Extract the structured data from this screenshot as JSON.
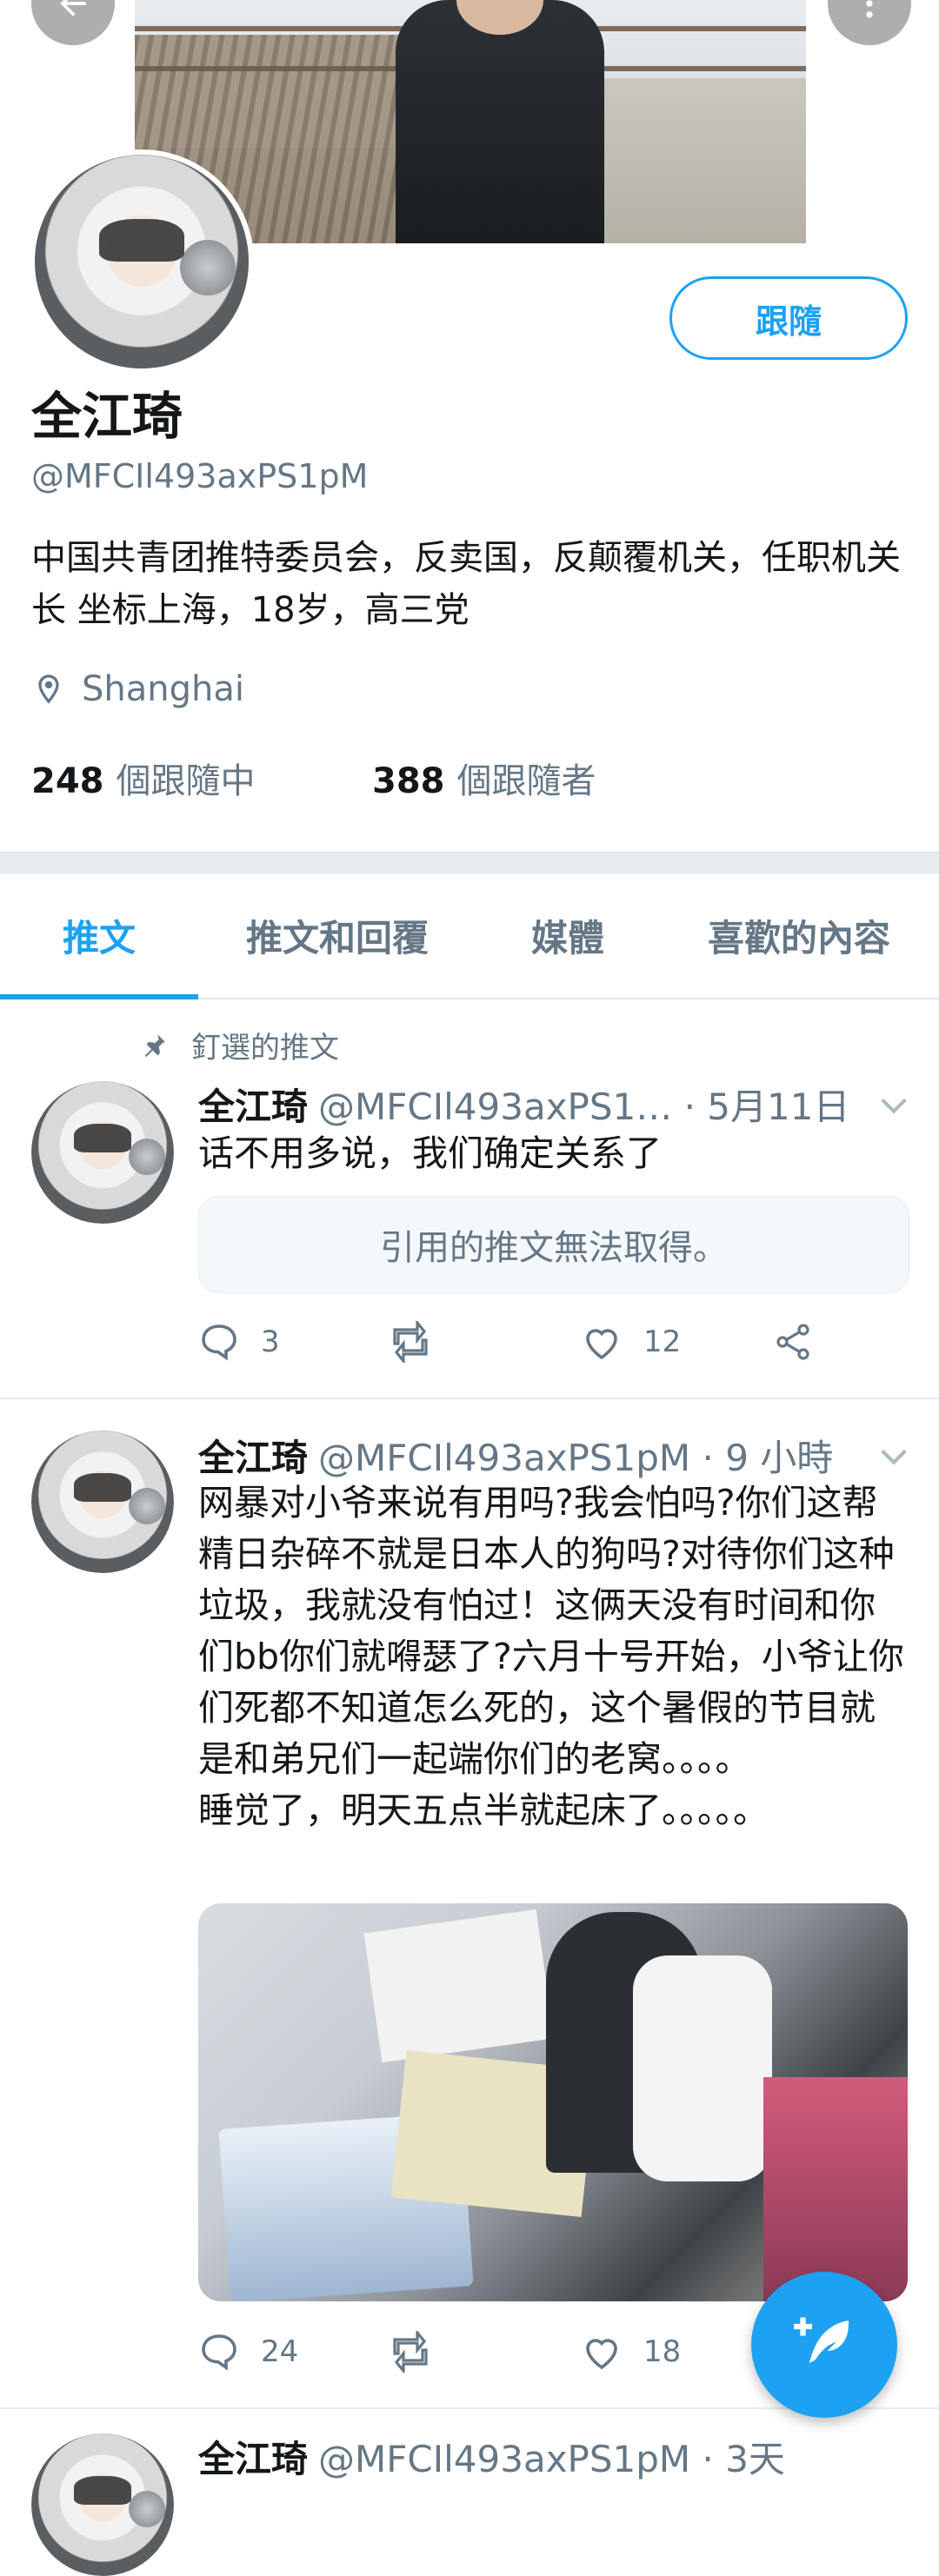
{
  "header": {
    "back_icon": "arrow-left-icon",
    "more_icon": "more-vertical-icon",
    "follow_label": "跟隨"
  },
  "profile": {
    "name": "全江琦",
    "handle": "@MFCIl493axPS1pM",
    "bio": "中国共青团推特委员会，反卖国，反颠覆机关，任职机关长 坐标上海，18岁，高三党",
    "location": "Shanghai",
    "following_count": "248",
    "following_label": "個跟隨中",
    "followers_count": "388",
    "followers_label": "個跟隨者"
  },
  "tabs": [
    {
      "label": "推文",
      "active": true
    },
    {
      "label": "推文和回覆",
      "active": false
    },
    {
      "label": "媒體",
      "active": false
    },
    {
      "label": "喜歡的內容",
      "active": false
    }
  ],
  "tweets": [
    {
      "pinned_label": "釘選的推文",
      "name": "全江琦",
      "meta": "@MFCIl493axPS1… · 5月11日",
      "text": "话不用多说，我们确定关系了",
      "quote": "引用的推文無法取得。",
      "replies": "3",
      "retweets": "",
      "likes": "12"
    },
    {
      "name": "全江琦",
      "meta": "@MFCIl493axPS1pM · 9 小時",
      "text": "网暴对小爷来说有用吗?我会怕吗?你们这帮精日杂碎不就是日本人的狗吗?对待你们这种垃圾，我就没有怕过！这俩天没有时间和你们bb你们就嘚瑟了?六月十号开始，小爷让你们死都不知道怎么死的，这个暑假的节目就是和弟兄们一起端你们的老窝。。。。\n睡觉了，明天五点半就起床了。。。。。",
      "replies": "24",
      "retweets": "",
      "likes": "18"
    },
    {
      "name": "全江琦",
      "meta": "@MFCIl493axPS1pM · 3天"
    }
  ],
  "fab_icon": "compose-tweet-icon",
  "colors": {
    "accent": "#1da1f2",
    "secondary_text": "#657786",
    "primary_text": "#14171a",
    "separator": "#e6ecf0"
  }
}
